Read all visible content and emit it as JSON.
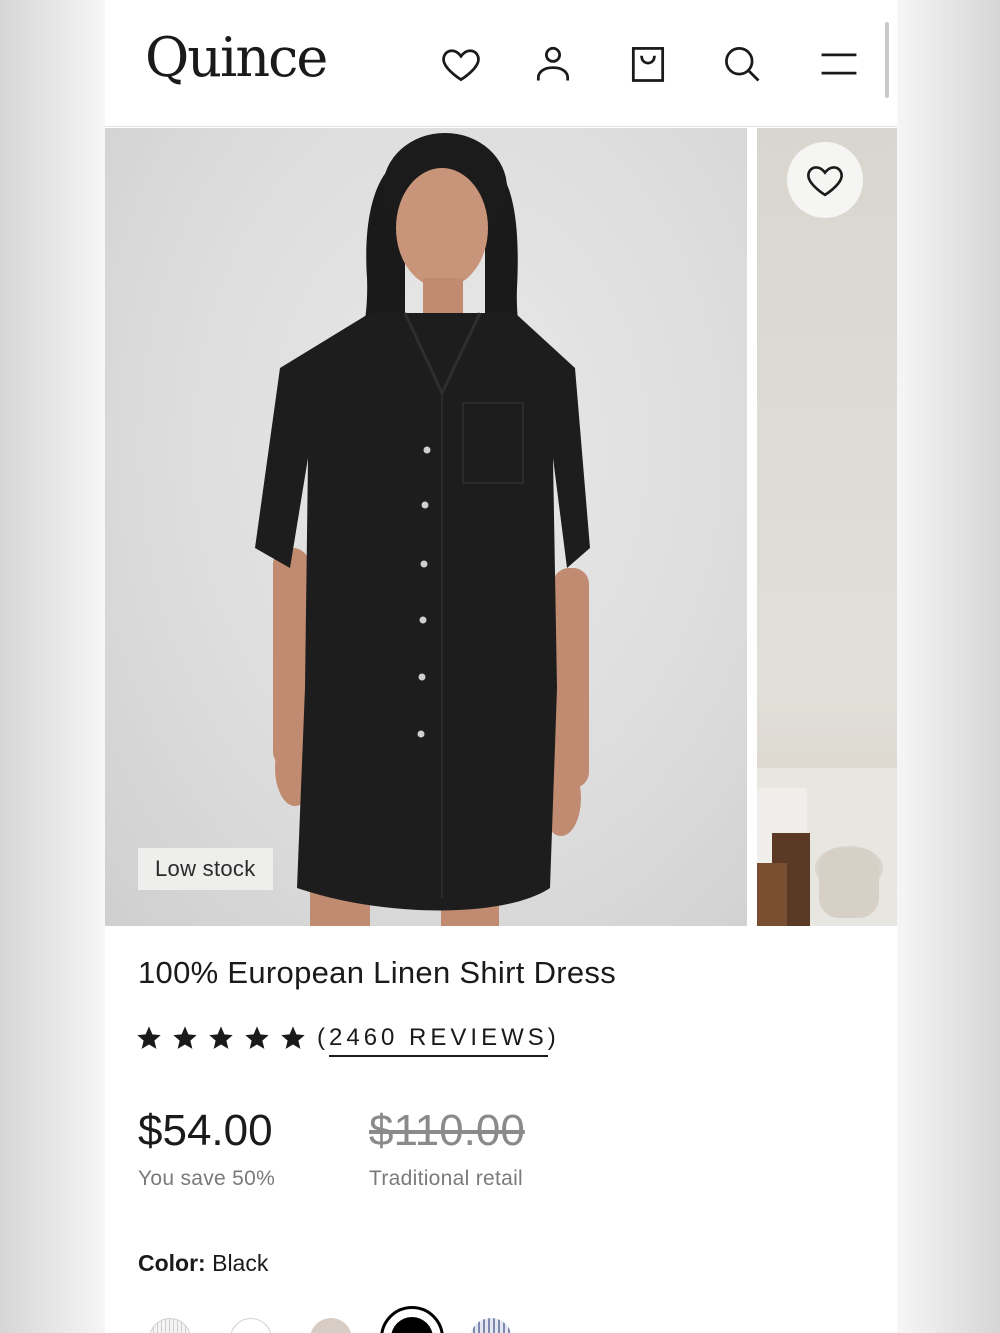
{
  "brand": {
    "logo_text": "Quince"
  },
  "header": {
    "icons": [
      "heart-icon",
      "account-icon",
      "bag-icon",
      "search-icon",
      "menu-icon"
    ]
  },
  "gallery": {
    "badge": "Low stock"
  },
  "product": {
    "title": "100% European Linen Shirt Dress",
    "rating": 5,
    "reviews_open": "(",
    "reviews_label": "2460 REVIEWS",
    "reviews_close": ")",
    "price": "$54.00",
    "savings": "You save 50%",
    "retail_price": "$110.00",
    "retail_label": "Traditional retail",
    "color_label": "Color:",
    "color_value": "Black"
  },
  "swatches": [
    {
      "name": "striped-white",
      "color": "#e9e9e9"
    },
    {
      "name": "white",
      "color": "#ffffff"
    },
    {
      "name": "beige",
      "color": "#d7cdc4"
    },
    {
      "name": "black",
      "color": "#000000",
      "selected": true
    },
    {
      "name": "striped-blue",
      "color": "#b9c2d9"
    }
  ],
  "colors": {
    "text": "#1a1a1a",
    "muted": "#7a7a7a"
  }
}
